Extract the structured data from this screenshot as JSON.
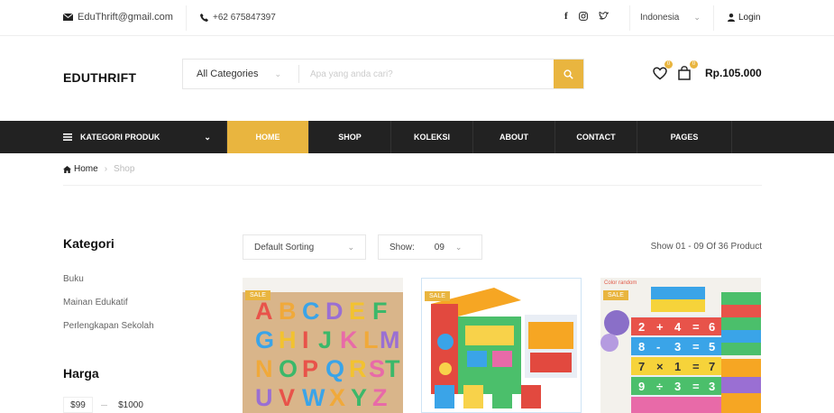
{
  "topbar": {
    "email": "EduThrift@gmail.com",
    "phone": "+62 675847397",
    "language": "Indonesia",
    "login": "Login"
  },
  "header": {
    "logo": "EDUTHRIFT",
    "category_select": "All Categories",
    "search_placeholder": "Apa yang anda cari?",
    "wishlist_count": "0",
    "cart_count": "0",
    "cart_total": "Rp.105.000"
  },
  "nav": {
    "categories_label": "KATEGORI PRODUK",
    "items": [
      {
        "label": "HOME",
        "active": true
      },
      {
        "label": "SHOP",
        "active": false
      },
      {
        "label": "KOLEKSI",
        "active": false
      },
      {
        "label": "ABOUT",
        "active": false
      },
      {
        "label": "CONTACT",
        "active": false
      },
      {
        "label": "PAGES",
        "active": false
      }
    ]
  },
  "breadcrumb": {
    "home": "Home",
    "current": "Shop"
  },
  "sidebar": {
    "kategori_title": "Kategori",
    "categories": [
      "Buku",
      "Mainan Edukatif",
      "Perlengkapan Sekolah"
    ],
    "harga_title": "Harga",
    "price_min": "$99",
    "price_max": "$1000"
  },
  "toolbar": {
    "sorting": "Default Sorting",
    "show_label": "Show:",
    "show_value": "09",
    "result_count": "Show 01 - 09 Of 36 Product"
  },
  "products": [
    {
      "badge": "SALE",
      "image": "alphabet-puzzle"
    },
    {
      "badge": "SALE",
      "image": "activity-cube"
    },
    {
      "badge": "SALE",
      "image": "math-cube-puzzle",
      "note": "Color random"
    }
  ],
  "colors": {
    "accent": "#e9b53f",
    "nav_bg": "#222222"
  }
}
